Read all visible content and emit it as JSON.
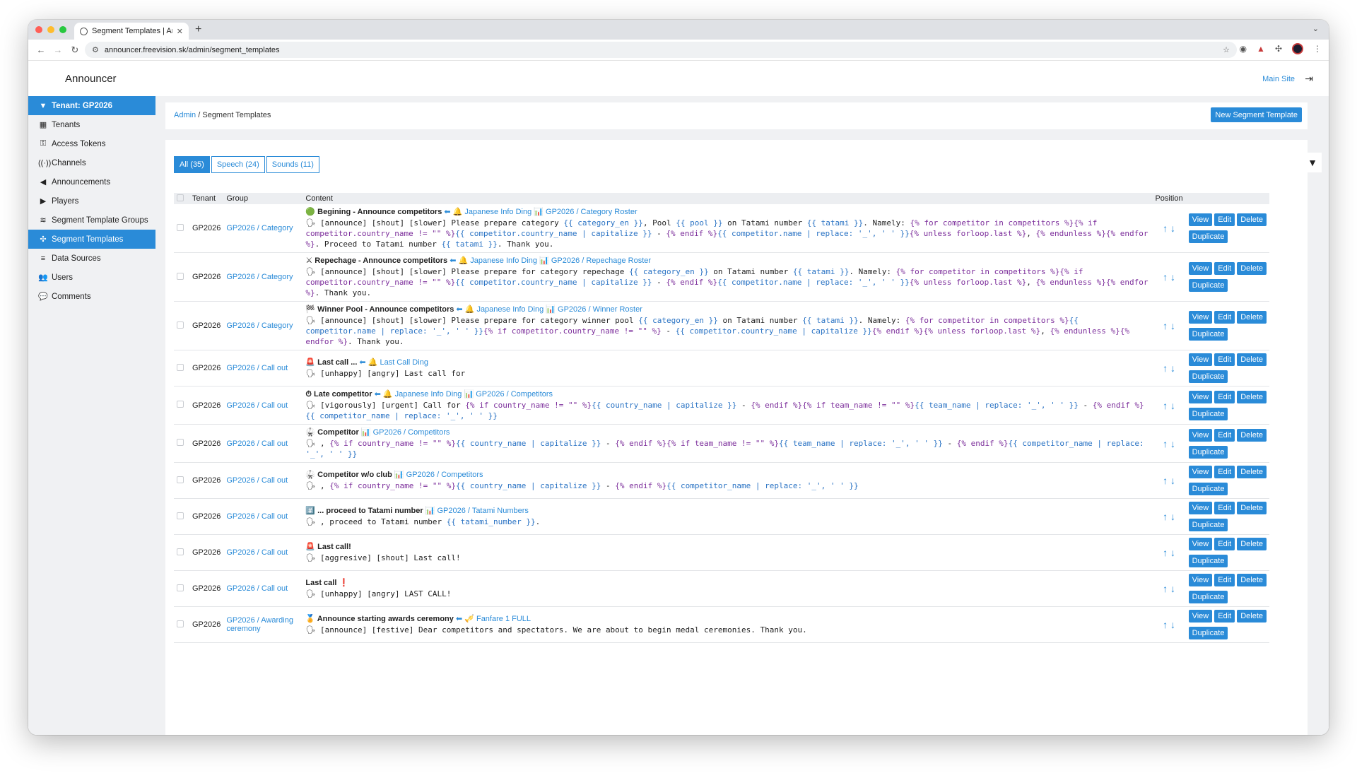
{
  "browser": {
    "tab_title": "Segment Templates | Announ",
    "url": "announcer.freevision.sk/admin/segment_templates"
  },
  "app": {
    "brand": "Announcer",
    "main_site": "Main Site"
  },
  "sidebar": {
    "tenant": "Tenant: GP2026",
    "items": [
      {
        "label": "Tenants",
        "icon": "building-icon"
      },
      {
        "label": "Access Tokens",
        "icon": "key-icon"
      },
      {
        "label": "Channels",
        "icon": "broadcast-icon"
      },
      {
        "label": "Announcements",
        "icon": "megaphone-icon"
      },
      {
        "label": "Players",
        "icon": "play-icon"
      },
      {
        "label": "Segment Template Groups",
        "icon": "layers-icon"
      },
      {
        "label": "Segment Templates",
        "icon": "puzzle-icon"
      },
      {
        "label": "Data Sources",
        "icon": "database-icon"
      },
      {
        "label": "Users",
        "icon": "users-icon"
      },
      {
        "label": "Comments",
        "icon": "comments-icon"
      }
    ]
  },
  "breadcrumb": {
    "root": "Admin",
    "sep": " / ",
    "current": "Segment Templates"
  },
  "new_button": "New Segment Template",
  "filters": [
    "All (35)",
    "Speech (24)",
    "Sounds (11)"
  ],
  "table": {
    "headers": {
      "tenant": "Tenant",
      "group": "Group",
      "content": "Content",
      "position": "Position"
    },
    "actions": {
      "view": "View",
      "edit": "Edit",
      "delete": "Delete",
      "duplicate": "Duplicate"
    },
    "arrows": "↑ ↓",
    "rows": [
      {
        "tenant": "GP2026",
        "group": "GP2026 / Category",
        "title": "🟢 Begining - Announce competitors",
        "links": " ⬅ 🔔 Japanese Info Ding 📊 GP2026 / Category Roster",
        "body": "🗣 [announce] [shout] [slower] Please prepare category {{ category_en }}, Pool {{ pool }} on Tatami number {{ tatami }}. Namely: {% for competitor in competitors %}{% if competitor.country_name != \"\" %}{{ competitor.country_name | capitalize }} - {% endif %}{{ competitor.name | replace: '_', ' ' }}{% unless forloop.last %}, {% endunless %}{% endfor %}. Proceed to Tatami number {{ tatami }}. Thank you."
      },
      {
        "tenant": "GP2026",
        "group": "GP2026 / Category",
        "title": "⚔ Repechage - Announce competitors",
        "links": " ⬅ 🔔 Japanese Info Ding 📊 GP2026 / Repechage Roster",
        "body": "🗣 [announce] [shout] [slower] Please prepare for category repechage {{ category_en }} on Tatami number {{ tatami }}. Namely: {% for competitor in competitors %}{% if competitor.country_name != \"\" %}{{ competitor.country_name | capitalize }} - {% endif %}{{ competitor.name | replace: '_', ' ' }}{% unless forloop.last %}, {% endunless %}{% endfor %}. Thank you."
      },
      {
        "tenant": "GP2026",
        "group": "GP2026 / Category",
        "title": "🏁 Winner Pool - Announce competitors",
        "links": " ⬅ 🔔 Japanese Info Ding 📊 GP2026 / Winner Roster",
        "body": "🗣 [announce] [shout] [slower] Please prepare for category winner pool {{ category_en }} on Tatami number {{ tatami }}. Namely: {% for competitor in competitors %}{{ competitor.name | replace: '_', ' ' }}{% if competitor.country_name != \"\" %} - {{ competitor.country_name | capitalize }}{% endif %}{% unless forloop.last %}, {% endunless %}{% endfor %}. Thank you."
      },
      {
        "tenant": "GP2026",
        "group": "GP2026 / Call out",
        "title": "🚨 Last call ...",
        "links": " ⬅ 🔔 Last Call Ding",
        "body": "🗣 [unhappy] [angry] Last call for"
      },
      {
        "tenant": "GP2026",
        "group": "GP2026 / Call out",
        "title": "⏱ Late competitor",
        "links": " ⬅ 🔔 Japanese Info Ding 📊 GP2026 / Competitors",
        "body": "🗣 [vigorously] [urgent] Call for {% if country_name != \"\" %}{{ country_name | capitalize }} - {% endif %}{% if team_name != \"\" %}{{ team_name | replace: '_', ' ' }} - {% endif %}{{ competitor_name | replace: '_', ' ' }}"
      },
      {
        "tenant": "GP2026",
        "group": "GP2026 / Call out",
        "title": "🥋 Competitor",
        "links": " 📊 GP2026 / Competitors",
        "body": "🗣 , {% if country_name != \"\" %}{{ country_name | capitalize }} - {% endif %}{% if team_name != \"\" %}{{ team_name | replace: '_', ' ' }} - {% endif %}{{ competitor_name | replace: '_', ' ' }}"
      },
      {
        "tenant": "GP2026",
        "group": "GP2026 / Call out",
        "title": "🥋 Competitor w/o club",
        "links": " 📊 GP2026 / Competitors",
        "body": "🗣 , {% if country_name != \"\" %}{{ country_name | capitalize }} - {% endif %}{{ competitor_name | replace: '_', ' ' }}"
      },
      {
        "tenant": "GP2026",
        "group": "GP2026 / Call out",
        "title": "#️⃣ ... proceed to Tatami number",
        "links": " 📊 GP2026 / Tatami Numbers",
        "body": "🗣 , proceed to Tatami number {{ tatami_number }}."
      },
      {
        "tenant": "GP2026",
        "group": "GP2026 / Call out",
        "title": "🚨 Last call!",
        "links": "",
        "body": "🗣 [aggresive] [shout] Last call!"
      },
      {
        "tenant": "GP2026",
        "group": "GP2026 / Call out",
        "title": "Last call ❗",
        "links": "",
        "body": "🗣 [unhappy] [angry] LAST CALL!"
      },
      {
        "tenant": "GP2026",
        "group": "GP2026 / Awarding ceremony",
        "title": "🏅 Announce starting awards ceremony",
        "links": " ⬅ 🎺 Fanfare 1 FULL",
        "body": "🗣 [announce] [festive] Dear competitors and spectators. We are about to begin medal ceremonies. Thank you."
      }
    ]
  }
}
